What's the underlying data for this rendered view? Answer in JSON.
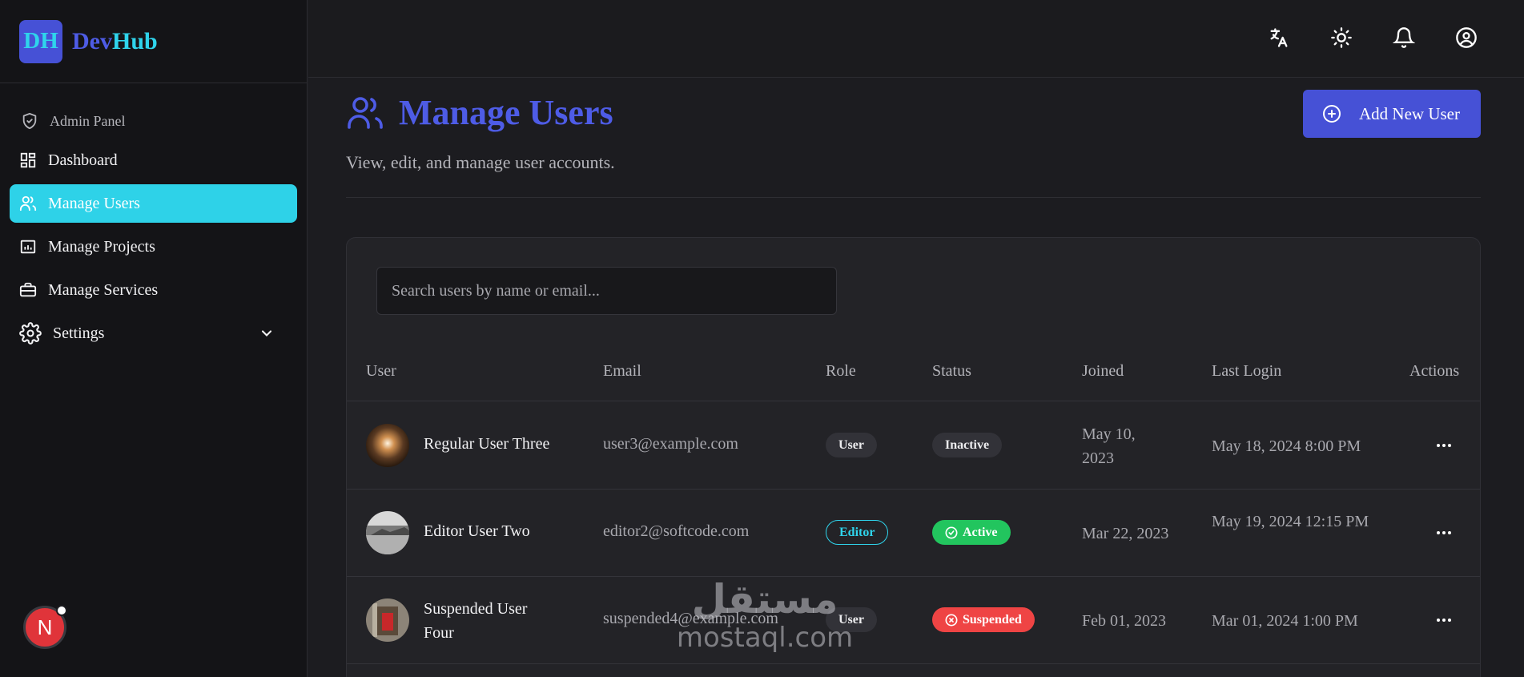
{
  "brand": {
    "logo": "DH",
    "name_part1": "Dev",
    "name_part2": "Hub"
  },
  "sidebar": {
    "section_label": "Admin Panel",
    "items": [
      {
        "label": "Dashboard",
        "icon": "dashboard-icon"
      },
      {
        "label": "Manage Users",
        "icon": "users-icon",
        "active": true
      },
      {
        "label": "Manage Projects",
        "icon": "projects-icon"
      },
      {
        "label": "Manage Services",
        "icon": "briefcase-icon"
      },
      {
        "label": "Settings",
        "icon": "gear-icon",
        "has_submenu": true
      }
    ]
  },
  "fab": {
    "letter": "N"
  },
  "topbar": {
    "icons": [
      "translate-icon",
      "sun-icon",
      "bell-icon",
      "user-circle-icon"
    ]
  },
  "page": {
    "title": "Manage Users",
    "subtitle": "View, edit, and manage user accounts.",
    "add_button": "Add New User"
  },
  "search": {
    "placeholder": "Search users by name or email..."
  },
  "table": {
    "headers": [
      "User",
      "Email",
      "Role",
      "Status",
      "Joined",
      "Last Login",
      "Actions"
    ],
    "rows": [
      {
        "name": "Regular User Three",
        "email": "user3@example.com",
        "role": "User",
        "status": "Inactive",
        "joined": "May 10, 2023",
        "last_login": "May 18, 2024 8:00 PM"
      },
      {
        "name": "Editor User Two",
        "email": "editor2@softcode.com",
        "role": "Editor",
        "status": "Active",
        "joined": "Mar 22, 2023",
        "last_login": "May 19, 2024 12:15 PM"
      },
      {
        "name": "Suspended User Four",
        "email": "suspended4@example.com",
        "role": "User",
        "status": "Suspended",
        "joined": "Feb 01, 2023",
        "last_login": "Mar 01, 2024 1:00 PM"
      }
    ]
  },
  "watermark": {
    "arabic": "مستقل",
    "latin": "mostaql.com"
  },
  "colors": {
    "accent": "#4651d6",
    "cyan": "#2ed2e8",
    "active": "#22c55e",
    "suspended": "#ef4444"
  }
}
